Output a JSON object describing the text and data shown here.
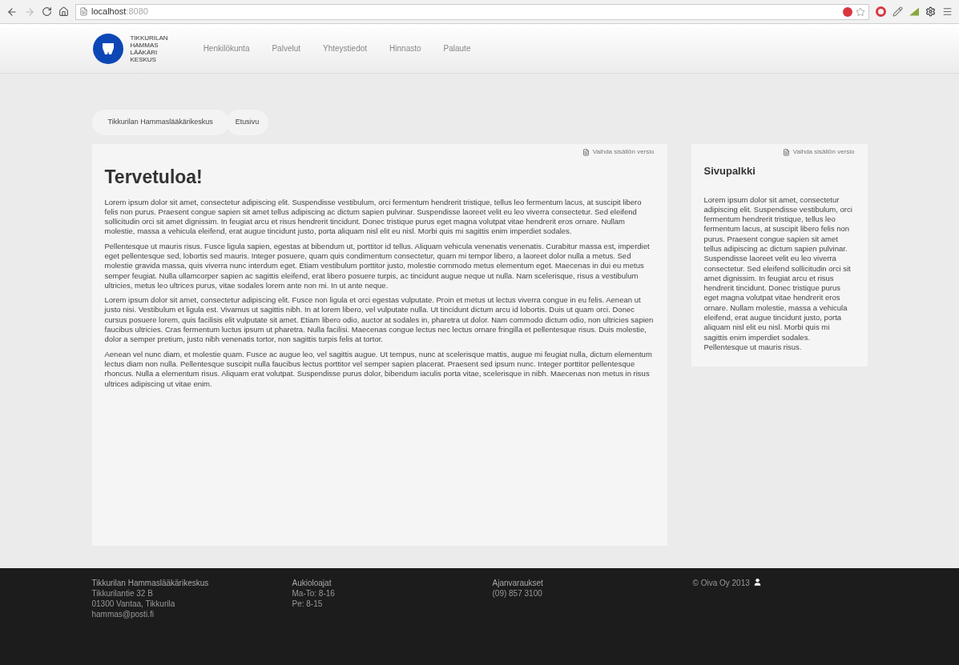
{
  "browser": {
    "url_host": "localhost",
    "url_port": ":8080"
  },
  "header": {
    "logo_lines": [
      "TIKKURILAN",
      "HAMMAS",
      "LÄÄKÄRI",
      "KESKUS"
    ],
    "nav": [
      {
        "label": "Henkilökunta"
      },
      {
        "label": "Palvelut"
      },
      {
        "label": "Yhteystiedot"
      },
      {
        "label": "Hinnasto"
      },
      {
        "label": "Palaute"
      }
    ]
  },
  "breadcrumb": [
    {
      "label": "Tikkurilan Hammaslääkärikeskus"
    },
    {
      "label": "Etusivu"
    }
  ],
  "main": {
    "edit_link": "Vaihda sisällön versio",
    "title": "Tervetuloa!",
    "paragraphs": [
      "Lorem ipsum dolor sit amet, consectetur adipiscing elit. Suspendisse vestibulum, orci fermentum hendrerit tristique, tellus leo fermentum lacus, at suscipit libero felis non purus. Praesent congue sapien sit amet tellus adipiscing ac dictum sapien pulvinar. Suspendisse laoreet velit eu leo viverra consectetur. Sed eleifend sollicitudin orci sit amet dignissim. In feugiat arcu et risus hendrerit tincidunt. Donec tristique purus eget magna volutpat vitae hendrerit eros ornare. Nullam molestie, massa a vehicula eleifend, erat augue tincidunt justo, porta aliquam nisl elit eu nisl. Morbi quis mi sagittis enim imperdiet sodales.",
      "Pellentesque ut mauris risus. Fusce ligula sapien, egestas at bibendum ut, porttitor id tellus. Aliquam vehicula venenatis venenatis. Curabitur massa est, imperdiet eget pellentesque sed, lobortis sed mauris. Integer posuere, quam quis condimentum consectetur, quam mi tempor libero, a laoreet dolor nulla a metus. Sed molestie gravida massa, quis viverra nunc interdum eget. Etiam vestibulum porttitor justo, molestie commodo metus elementum eget. Maecenas in dui eu metus semper feugiat. Nulla ullamcorper sapien ac sagittis eleifend, erat libero posuere turpis, ac tincidunt augue neque ut nulla. Nam scelerisque, risus a vestibulum ultricies, metus leo ultrices purus, vitae sodales lorem ante non mi. In ut ante neque.",
      "Lorem ipsum dolor sit amet, consectetur adipiscing elit. Fusce non ligula et orci egestas vulputate. Proin et metus ut lectus viverra congue in eu felis. Aenean ut justo nisi. Vestibulum et ligula est. Vivamus ut sagittis nibh. In at lorem libero, vel vulputate nulla. Ut tincidunt dictum arcu id lobortis. Duis ut quam orci. Donec cursus posuere lorem, quis facilisis elit vulputate sit amet. Etiam libero odio, auctor at sodales in, pharetra ut dolor. Nam commodo dictum odio, non ultricies sapien faucibus ultricies. Cras fermentum luctus ipsum ut pharetra. Nulla facilisi. Maecenas congue lectus nec lectus ornare fringilla et pellentesque risus. Duis molestie, dolor a semper pretium, justo nibh venenatis tortor, non sagittis turpis felis at tortor.",
      "Aenean vel nunc diam, et molestie quam. Fusce ac augue leo, vel sagittis augue. Ut tempus, nunc at scelerisque mattis, augue mi feugiat nulla, dictum elementum lectus diam non nulla. Pellentesque suscipit nulla faucibus lectus porttitor vel semper sapien placerat. Praesent sed ipsum nunc. Integer porttitor pellentesque rhoncus. Nulla a elementum risus. Aliquam erat volutpat. Suspendisse purus dolor, bibendum iaculis porta vitae, scelerisque in nibh. Maecenas non metus in risus ultrices adipiscing ut vitae enim."
    ]
  },
  "sidebar": {
    "edit_link": "Vaihda sisällön versio",
    "title": "Sivupalkki",
    "paragraphs": [
      "Lorem ipsum dolor sit amet, consectetur adipiscing elit. Suspendisse vestibulum, orci fermentum hendrerit tristique, tellus leo fermentum lacus, at suscipit libero felis non purus. Praesent congue sapien sit amet tellus adipiscing ac dictum sapien pulvinar. Suspendisse laoreet velit eu leo viverra consectetur. Sed eleifend sollicitudin orci sit amet dignissim. In feugiat arcu et risus hendrerit tincidunt. Donec tristique purus eget magna volutpat vitae hendrerit eros ornare. Nullam molestie, massa a vehicula eleifend, erat augue tincidunt justo, porta aliquam nisl elit eu nisl. Morbi quis mi sagittis enim imperdiet sodales. Pellentesque ut mauris risus."
    ]
  },
  "footer": {
    "columns": [
      {
        "heading": "Tikkurilan Hammaslääkärikeskus",
        "lines": [
          "Tikkurilantie 32 B",
          "01300 Vantaa, Tikkurila",
          "hammas@posti.fi"
        ]
      },
      {
        "heading": "Aukioloajat",
        "lines": [
          "Ma-To: 8-16",
          "Pe: 8-15"
        ]
      },
      {
        "heading": "Ajanvaraukset",
        "lines": [
          "(09) 857 3100"
        ]
      }
    ],
    "copyright": "© Oiva Oy 2013"
  }
}
